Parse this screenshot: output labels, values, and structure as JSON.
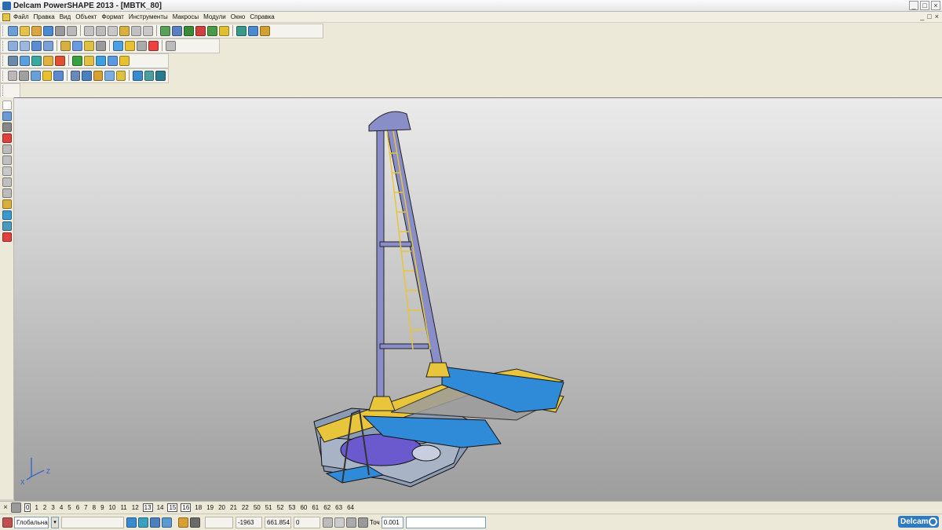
{
  "window": {
    "title": "Delcam PowerSHAPE 2013 - [MBTK_80]",
    "min": "_",
    "max": "□",
    "close": "×"
  },
  "menu": {
    "items": [
      "Файл",
      "Правка",
      "Вид",
      "Объект",
      "Формат",
      "Инструменты",
      "Макросы",
      "Модули",
      "Окно",
      "Справка"
    ],
    "mdi": [
      "_",
      "□",
      "×"
    ]
  },
  "toolbars": {
    "row1_colors": [
      "#6a9fd8",
      "#e4c24a",
      "#d9a640",
      "#4a8ad0",
      "#999",
      "#b9b9b9",
      "#c3c3c3",
      "#bbbbbb",
      "#c8c8c8",
      "#d8b040",
      "#c0c0c0",
      "#c8c8c8",
      "#5aa05a",
      "#5a7fc0",
      "#3a8a3a",
      "#d04040",
      "#4a9a4a",
      "#e0c030",
      "#3a9a8a",
      "#4a8ad0",
      "#d0a030"
    ],
    "row2_colors": [
      "#8aaedc",
      "#9ab8e0",
      "#5a8ed0",
      "#7aa0d8",
      "#d8b040",
      "#6a9be0",
      "#e0c040",
      "#9a9a9a",
      "#4aa0e0",
      "#e8c030",
      "#aaaaaa",
      "#ee4040",
      "#bbbbbb"
    ],
    "row3_colors": [
      "#6a8aa8",
      "#5aa0e0",
      "#3aa8a0",
      "#e0b040",
      "#e05030",
      "#3aa040",
      "#e0c040",
      "#3aa0e0",
      "#5a9ae0",
      "#e8c030"
    ],
    "row4_colors": [
      "#b8b8b8",
      "#a0a0a0",
      "#6aa0d8",
      "#e8c030",
      "#5a8ad0",
      "#6a8ab8",
      "#4a80c0",
      "#d8a030",
      "#7ab0e0",
      "#e0c040",
      "#3a8ad0",
      "#4aa0a0",
      "#2a7a90"
    ]
  },
  "left_toolbar_colors": [
    "#ffffff",
    "#6a9ad8",
    "#888888",
    "#e04040",
    "#bbbbbb",
    "#c0c0c0",
    "#c8c8c8",
    "#c0c0c0",
    "#bbbbbb",
    "#d8b040",
    "#3a9ad0",
    "#4a9ac0",
    "#e04040"
  ],
  "viewport": {
    "axis_z": "Z",
    "axis_x": "X"
  },
  "levels": {
    "close": "×",
    "items": [
      "0",
      "1",
      "2",
      "3",
      "4",
      "5",
      "6",
      "7",
      "8",
      "9",
      "10",
      "11",
      "12",
      "13",
      "14",
      "15",
      "16",
      "18",
      "19",
      "20",
      "21",
      "22",
      "50",
      "51",
      "52",
      "53",
      "60",
      "61",
      "62",
      "63",
      "64"
    ],
    "boxed": [
      "0",
      "13",
      "15",
      "16"
    ]
  },
  "status": {
    "workplane": "Глобальна",
    "workplane_arrow": "▾",
    "unnamed_field": "",
    "x": "-1963",
    "y": "661.854",
    "z": "0",
    "tolerance_label": "Точ",
    "tolerance": "0.001",
    "message": "",
    "logo": "Delcam"
  }
}
